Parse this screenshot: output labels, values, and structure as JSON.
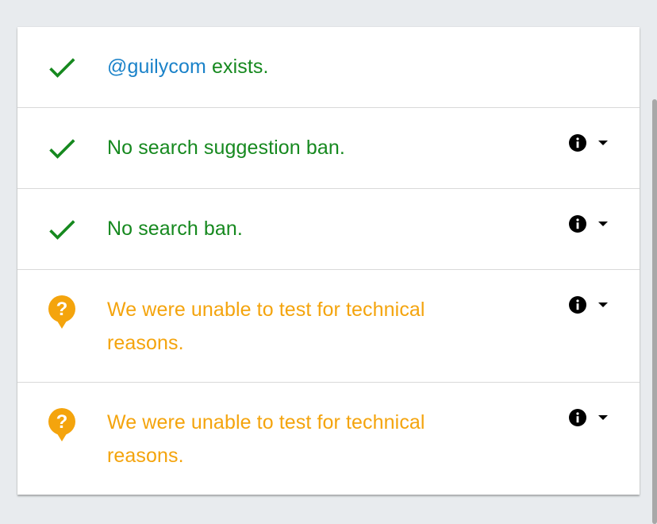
{
  "rows": [
    {
      "status": "success",
      "icon": "check-icon",
      "handle": "@guilycom",
      "text": " exists."
    },
    {
      "status": "success",
      "icon": "check-icon",
      "text": "No search suggestion ban.",
      "info_icon": "info-icon",
      "dropdown_icon": "caret-down-icon"
    },
    {
      "status": "success",
      "icon": "check-icon",
      "text": "No search ban.",
      "info_icon": "info-icon",
      "dropdown_icon": "caret-down-icon"
    },
    {
      "status": "warning",
      "icon": "question-bubble-icon",
      "text": "We were unable to test for technical reasons.",
      "info_icon": "info-icon",
      "dropdown_icon": "caret-down-icon"
    },
    {
      "status": "warning",
      "icon": "question-bubble-icon",
      "text": "We were unable to test for technical reasons.",
      "info_icon": "info-icon",
      "dropdown_icon": "caret-down-icon"
    }
  ],
  "colors": {
    "success": "#16891f",
    "warning": "#f4a40d",
    "handle": "#1a82c9",
    "background": "#e8ebee"
  }
}
